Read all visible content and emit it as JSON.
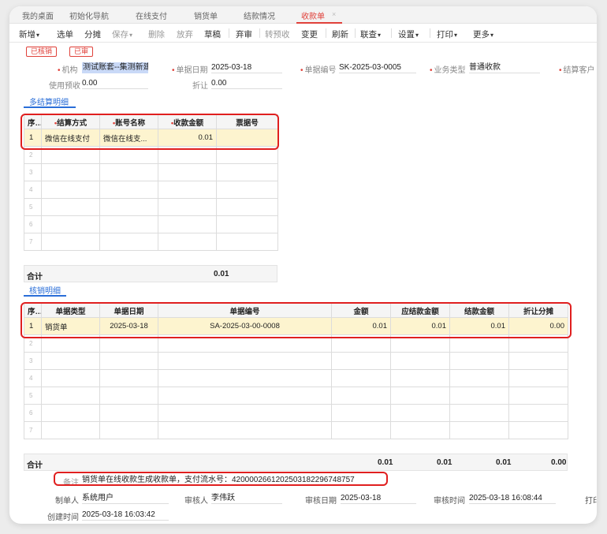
{
  "tabs": [
    {
      "label": "我的桌面",
      "active": false
    },
    {
      "label": "初始化导航",
      "active": false
    },
    {
      "label": "在线支付",
      "active": false
    },
    {
      "label": "销货单",
      "active": false
    },
    {
      "label": "结款情况",
      "active": false
    },
    {
      "label": "收款单",
      "active": true
    }
  ],
  "tab_close": "×",
  "toolbar": {
    "add": "新增",
    "select": "选单",
    "split": "分摊",
    "save": "保存",
    "delete": "删除",
    "discard": "放弃",
    "draft": "草稿",
    "unaudit": "弃审",
    "prepay": "转预收",
    "change": "变更",
    "refresh": "刷新",
    "query": "联查",
    "settings": "设置",
    "print": "打印",
    "more": "更多"
  },
  "badges": {
    "verified": "已核销",
    "audited": "已审"
  },
  "form": {
    "org_label": "机构",
    "org_value": "测试账套--集测新建",
    "date_label": "单据日期",
    "date_value": "2025-03-18",
    "code_label": "单据编号",
    "code_value": "SK-2025-03-0005",
    "biztype_label": "业务类型",
    "biztype_value": "普通收款",
    "customer_label": "结算客户",
    "prepay_label": "使用预收",
    "prepay_value": "0.00",
    "discount_label": "折让",
    "discount_value": "0.00"
  },
  "settlement": {
    "section_title": "多结算明细",
    "headers": [
      "序号",
      "结算方式",
      "账号名称",
      "收款金额",
      "票据号"
    ],
    "rows": [
      {
        "idx": "1",
        "method": "微信在线支付",
        "account": "微信在线支...",
        "amount": "0.01",
        "ticket": ""
      }
    ],
    "empty_idx": [
      "2",
      "3",
      "4",
      "5",
      "6",
      "7"
    ],
    "total_label": "合计",
    "total_amount": "0.01"
  },
  "writeoff": {
    "section_title": "核销明细",
    "headers": [
      "序号",
      "单据类型",
      "单据日期",
      "单据编号",
      "金额",
      "应结款金额",
      "结款金额",
      "折让分摊"
    ],
    "rows": [
      {
        "idx": "1",
        "type": "销货单",
        "date": "2025-03-18",
        "code": "SA-2025-03-00-0008",
        "amount": "0.01",
        "due": "0.01",
        "paid": "0.01",
        "discount": "0.00"
      }
    ],
    "empty_idx": [
      "2",
      "3",
      "4",
      "5",
      "6",
      "7"
    ],
    "total_label": "合计",
    "totals": {
      "amount": "0.01",
      "due": "0.01",
      "paid": "0.01",
      "discount": "0.00"
    }
  },
  "remark": {
    "label": "备注",
    "value": "销货单在线收款生成收款单，支付流水号：4200002661202503182296748757"
  },
  "footer": {
    "maker_label": "制单人",
    "maker_value": "系统用户",
    "auditor_label": "审核人",
    "auditor_value": "李伟跃",
    "audit_date_label": "审核日期",
    "audit_date_value": "2025-03-18",
    "audit_time_label": "审核时间",
    "audit_time_value": "2025-03-18 16:08:44",
    "print_label": "打印",
    "created_label": "创建时间",
    "created_value": "2025-03-18 16:03:42"
  }
}
